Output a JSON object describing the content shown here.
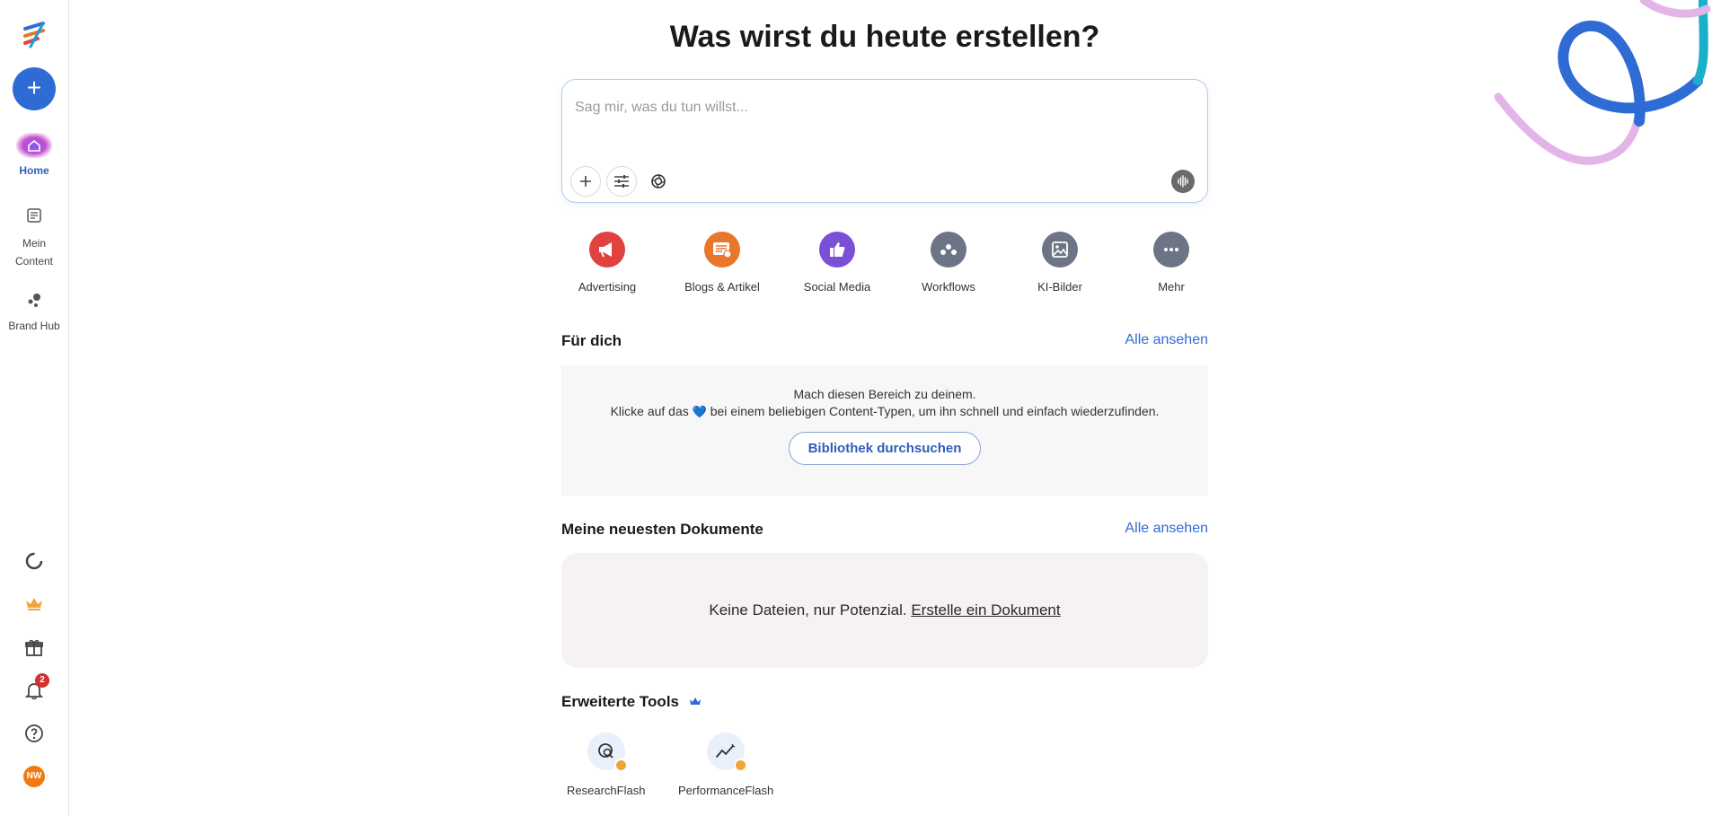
{
  "sidebar": {
    "new_label": "+",
    "items": [
      {
        "label": "Home",
        "icon": "home-icon"
      },
      {
        "label": "Mein Content",
        "icon": "content-icon"
      },
      {
        "label": "Brand Hub",
        "icon": "brand-hub-icon"
      }
    ],
    "bottom": {
      "notifications_count": "2",
      "avatar_initials": "NW"
    }
  },
  "main": {
    "title": "Was wirst du heute erstellen?",
    "prompt": {
      "placeholder": "Sag mir, was du tun willst..."
    },
    "categories": [
      {
        "label": "Advertising",
        "icon": "megaphone-icon",
        "color": "#e0433f"
      },
      {
        "label": "Blogs & Artikel",
        "icon": "blog-icon",
        "color": "#e8762b"
      },
      {
        "label": "Social Media",
        "icon": "thumbs-up-icon",
        "color": "#7b4fd6"
      },
      {
        "label": "Workflows",
        "icon": "workflow-icon",
        "color": "#6c7486"
      },
      {
        "label": "KI-Bilder",
        "icon": "image-icon",
        "color": "#6c7486"
      },
      {
        "label": "Mehr",
        "icon": "more-icon",
        "color": "#6c7486"
      }
    ],
    "fuer_dich": {
      "heading": "Für dich",
      "link": "Alle ansehen",
      "line1": "Mach diesen Bereich zu deinem.",
      "line2_pre": "Klicke auf das",
      "line2_post": "bei einem beliebigen Content-Typen, um ihn schnell und einfach wiederzufinden.",
      "button": "Bibliothek durchsuchen"
    },
    "documents": {
      "heading": "Meine neuesten Dokumente",
      "link": "Alle ansehen",
      "empty_text": "Keine Dateien, nur Potenzial.",
      "cta": "Erstelle ein Dokument"
    },
    "tools": {
      "heading": "Erweiterte Tools",
      "items": [
        {
          "label": "ResearchFlash",
          "icon": "research-icon"
        },
        {
          "label": "PerformanceFlash",
          "icon": "performance-icon"
        }
      ]
    }
  },
  "colors": {
    "accent": "#2f6bd4",
    "link": "#2f6bd4",
    "premium": "#f2a33a"
  }
}
